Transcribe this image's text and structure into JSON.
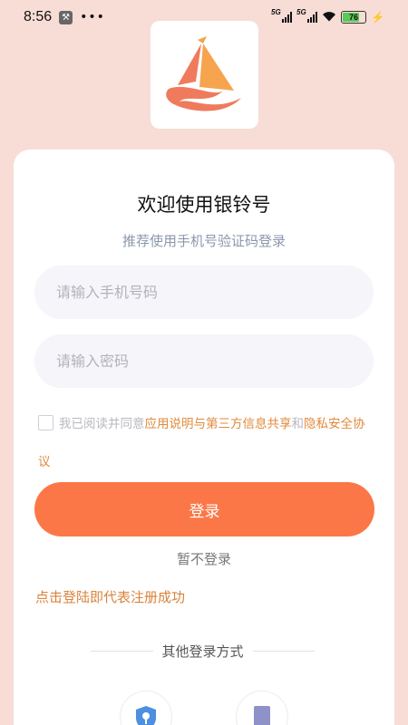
{
  "status_bar": {
    "time": "8:56",
    "network1": "5G",
    "network2": "5G",
    "battery": "76",
    "battery_level": 0.76,
    "icons": [
      "wrench-icon",
      "more-dots-icon",
      "signal-icon",
      "wifi-icon",
      "battery-icon",
      "charging-bolt-icon"
    ]
  },
  "app": {
    "title": "欢迎使用银铃号",
    "subtitle": "推荐使用手机号验证码登录"
  },
  "form": {
    "phone_placeholder": "请输入手机号码",
    "password_placeholder": "请输入密码"
  },
  "agreement": {
    "prefix": "我已阅读并同意",
    "link1": "应用说明与第三方信息共享",
    "connector": "和",
    "link2": "隐私安全协议"
  },
  "actions": {
    "login": "登录",
    "skip": "暂不登录",
    "notice": "点击登陆即代表注册成功",
    "other_methods": "其他登录方式"
  },
  "colors": {
    "background": "#f7ddd6",
    "accent": "#fc7747",
    "link": "#e08a3c"
  }
}
